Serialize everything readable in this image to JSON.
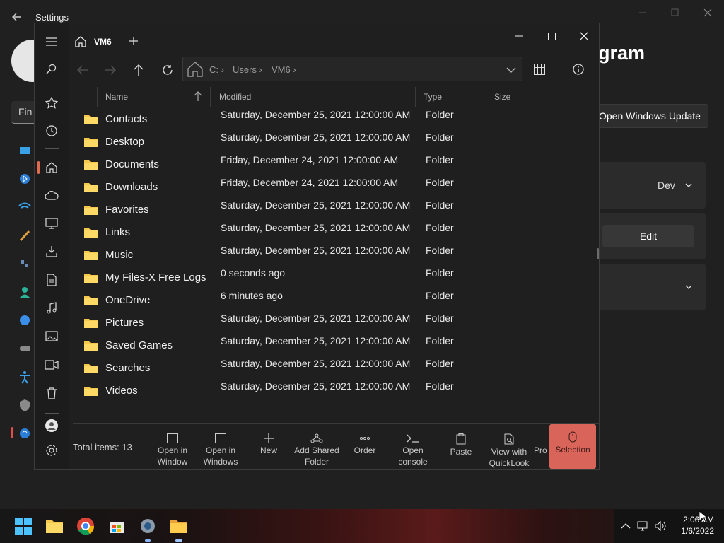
{
  "settings": {
    "title": "Settings",
    "search_placeholder": "Fin",
    "heading": "gram",
    "update_button": "Open Windows Update",
    "dev_label": "Dev",
    "edit_button": "Edit"
  },
  "tab": {
    "label": "VM6"
  },
  "address": {
    "crumbs": [
      "C: ›",
      "Users ›",
      "VM6 ›"
    ]
  },
  "columns": {
    "name": "Name",
    "modified": "Modified",
    "type": "Type",
    "size": "Size"
  },
  "rows": [
    {
      "name": "Contacts",
      "modified": "Saturday, December 25, 2021 12:00:00 AM",
      "type": "Folder"
    },
    {
      "name": "Desktop",
      "modified": "Saturday, December 25, 2021 12:00:00 AM",
      "type": "Folder"
    },
    {
      "name": "Documents",
      "modified": "Friday, December 24, 2021 12:00:00 AM",
      "type": "Folder"
    },
    {
      "name": "Downloads",
      "modified": "Friday, December 24, 2021 12:00:00 AM",
      "type": "Folder"
    },
    {
      "name": "Favorites",
      "modified": "Saturday, December 25, 2021 12:00:00 AM",
      "type": "Folder"
    },
    {
      "name": "Links",
      "modified": "Saturday, December 25, 2021 12:00:00 AM",
      "type": "Folder"
    },
    {
      "name": "Music",
      "modified": "Saturday, December 25, 2021 12:00:00 AM",
      "type": "Folder"
    },
    {
      "name": "My Files-X Free Logs",
      "modified": "0 seconds ago",
      "type": "Folder"
    },
    {
      "name": "OneDrive",
      "modified": "6 minutes ago",
      "type": "Folder"
    },
    {
      "name": "Pictures",
      "modified": "Saturday, December 25, 2021 12:00:00 AM",
      "type": "Folder"
    },
    {
      "name": "Saved Games",
      "modified": "Saturday, December 25, 2021 12:00:00 AM",
      "type": "Folder"
    },
    {
      "name": "Searches",
      "modified": "Saturday, December 25, 2021 12:00:00 AM",
      "type": "Folder"
    },
    {
      "name": "Videos",
      "modified": "Saturday, December 25, 2021 12:00:00 AM",
      "type": "Folder"
    }
  ],
  "footer": {
    "total": "Total items: 13",
    "actions": {
      "open_in_window": "Open in Window",
      "open_in_windows": "Open in Windows",
      "new": "New",
      "add_shared_folder": "Add Shared Folder",
      "order": "Order",
      "open_console": "Open console",
      "paste": "Paste",
      "view_quicklook": "View with QuickLook",
      "properties": "Pro",
      "selection": "Selection"
    }
  },
  "taskbar": {
    "time": "2:06 AM",
    "date": "1/6/2022"
  },
  "colors": {
    "accent": "#e26a4f",
    "selection": "#d9645a",
    "folder": "#f5c74a"
  }
}
